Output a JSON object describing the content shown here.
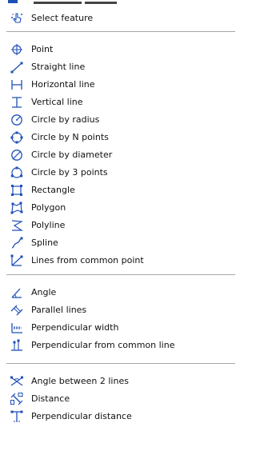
{
  "menu": {
    "select": {
      "label": "Select feature"
    },
    "g1": [
      {
        "key": "point",
        "label": "Point"
      },
      {
        "key": "straight",
        "label": "Straight line"
      },
      {
        "key": "horizontal",
        "label": "Horizontal line"
      },
      {
        "key": "vertical",
        "label": "Vertical line"
      },
      {
        "key": "circle-radius",
        "label": "Circle by radius"
      },
      {
        "key": "circle-npoints",
        "label": "Circle by N points"
      },
      {
        "key": "circle-diameter",
        "label": "Circle by diameter"
      },
      {
        "key": "circle-3points",
        "label": "Circle by 3 points"
      },
      {
        "key": "rectangle",
        "label": "Rectangle"
      },
      {
        "key": "polygon",
        "label": "Polygon"
      },
      {
        "key": "polyline",
        "label": "Polyline"
      },
      {
        "key": "spline",
        "label": "Spline"
      },
      {
        "key": "lines-common",
        "label": "Lines from common point"
      }
    ],
    "g2": [
      {
        "key": "angle",
        "label": "Angle"
      },
      {
        "key": "parallel",
        "label": "Parallel lines"
      },
      {
        "key": "perp-width",
        "label": "Perpendicular width"
      },
      {
        "key": "perp-common",
        "label": "Perpendicular from common line"
      }
    ],
    "g3": [
      {
        "key": "angle2",
        "label": "Angle between 2 lines"
      },
      {
        "key": "distance",
        "label": "Distance"
      },
      {
        "key": "perp-distance",
        "label": "Perpendicular distance"
      }
    ]
  },
  "colors": {
    "icon_blue": "#1e4fb8",
    "accent": "#0a64d2",
    "separator": "#a7a7a7"
  }
}
